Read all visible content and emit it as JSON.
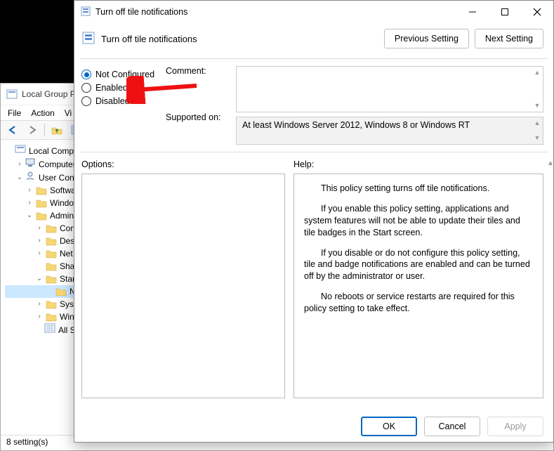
{
  "bg": {
    "title": "Local Group P",
    "menu": [
      "File",
      "Action",
      "Vi"
    ],
    "tree": {
      "root": "Local Compute",
      "computer": "Computer",
      "user": "User Config",
      "software": "Softwar",
      "windows": "Window",
      "admin": "Admini",
      "con": "Con",
      "des": "Des",
      "net": "Net",
      "shar": "Shar",
      "star": "Star",
      "leafN": "N",
      "syst": "Syst",
      "win": "Win",
      "alls": "All S"
    },
    "status": "8 setting(s)"
  },
  "dialog": {
    "title": "Turn off tile notifications",
    "subtitle": "Turn off tile notifications",
    "prev": "Previous Setting",
    "next": "Next Setting",
    "radios": {
      "notconf": "Not Configured",
      "enabled": "Enabled",
      "disabled": "Disabled"
    },
    "commentLabel": "Comment:",
    "supportedLabel": "Supported on:",
    "supportedText": "At least Windows Server 2012, Windows 8 or Windows RT",
    "optionsLabel": "Options:",
    "helpLabel": "Help:",
    "help": {
      "p1": "This policy setting turns off tile notifications.",
      "p2": "If you enable this policy setting, applications and system features will not be able to update their tiles and tile badges in the Start screen.",
      "p3": "If you disable or do not configure this policy setting, tile and badge notifications are enabled and can be turned off by the administrator or user.",
      "p4": "No reboots or service restarts are required for this policy setting to take effect."
    },
    "ok": "OK",
    "cancel": "Cancel",
    "apply": "Apply"
  }
}
